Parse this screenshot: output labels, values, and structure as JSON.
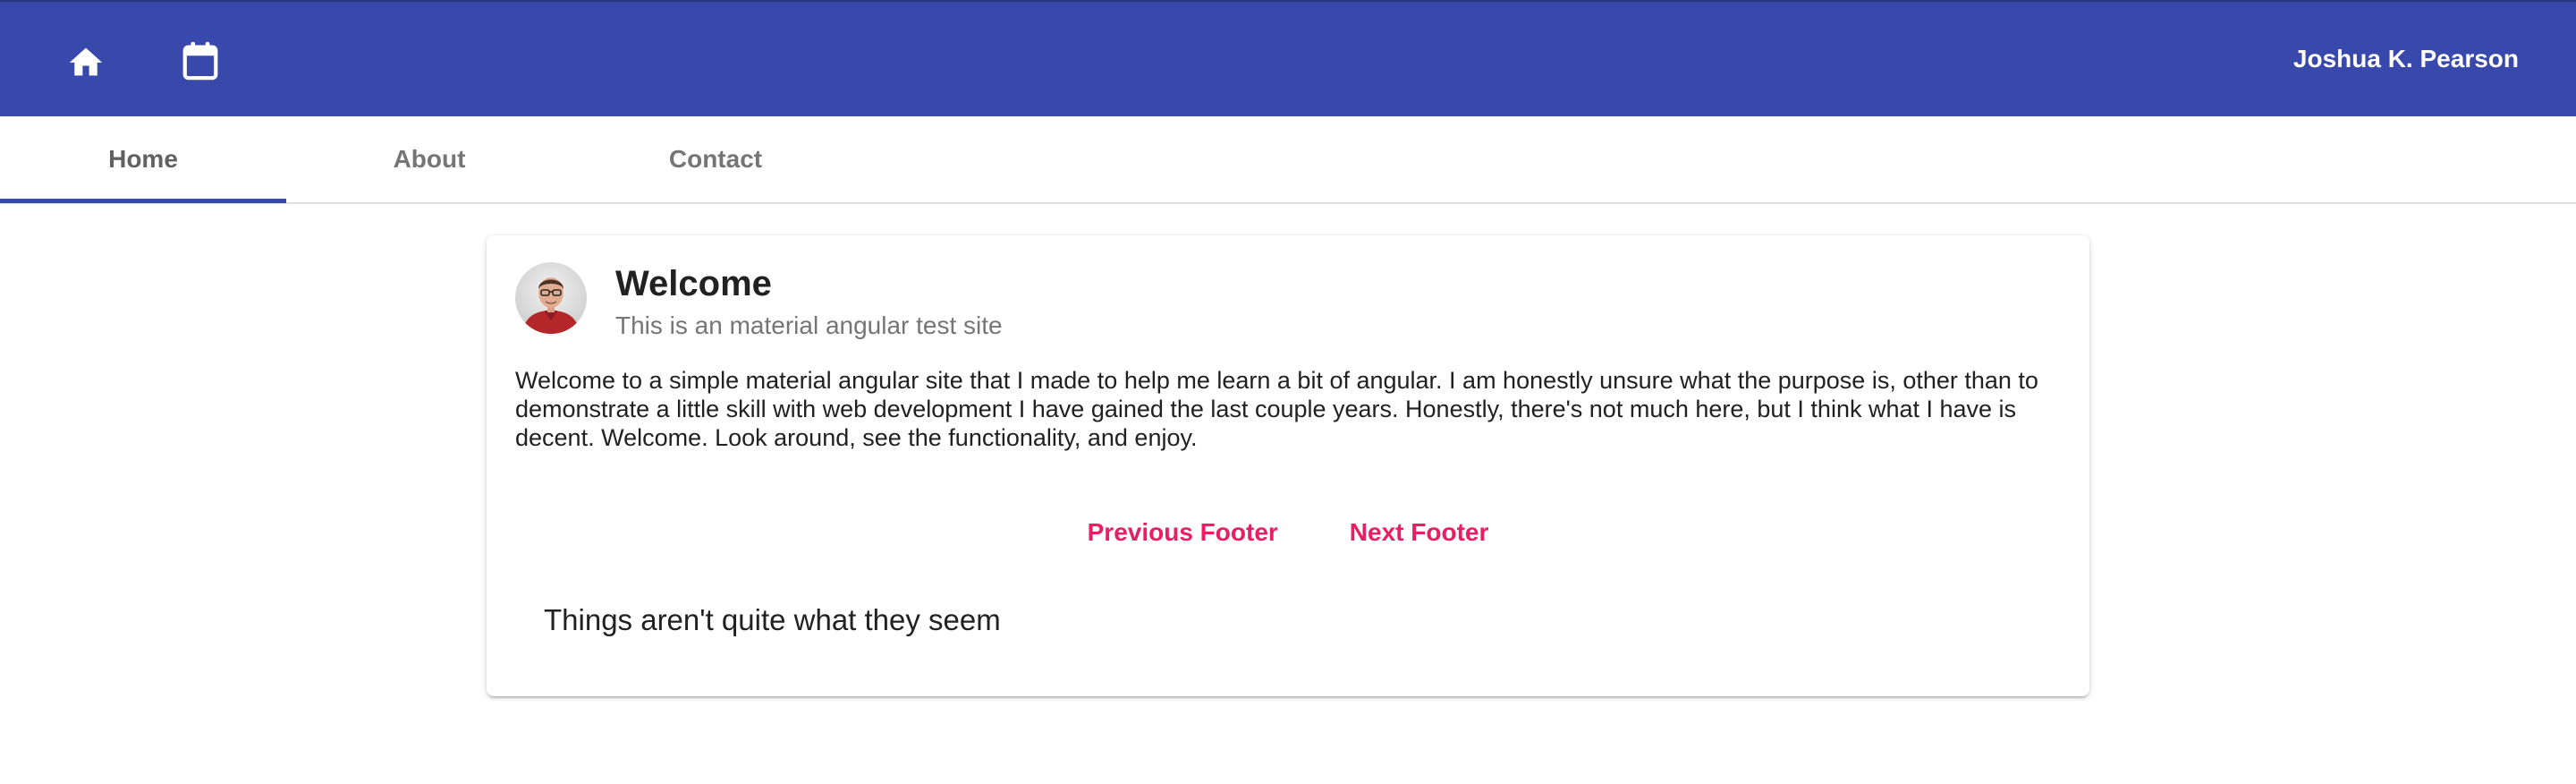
{
  "toolbar": {
    "home_icon": "home-icon",
    "calendar_icon": "calendar-icon",
    "user_name": "Joshua K. Pearson",
    "background_color": "#3949ab"
  },
  "tabs": [
    {
      "label": "Home",
      "active": true
    },
    {
      "label": "About",
      "active": false
    },
    {
      "label": "Contact",
      "active": false
    }
  ],
  "card": {
    "title": "Welcome",
    "subtitle": "This is an material angular test site",
    "body": "Welcome to a simple material angular site that I made to help me learn a bit of angular. I am honestly unsure what the purpose is, other than to demonstrate a little skill with web development I have gained the last couple years. Honestly, there's not much here, but I think what I have is decent. Welcome. Look around, see the functionality, and enjoy.",
    "actions": {
      "previous_label": "Previous Footer",
      "next_label": "Next Footer"
    },
    "footer_text": "Things aren't quite what they seem",
    "accent_color": "#e91e63"
  }
}
